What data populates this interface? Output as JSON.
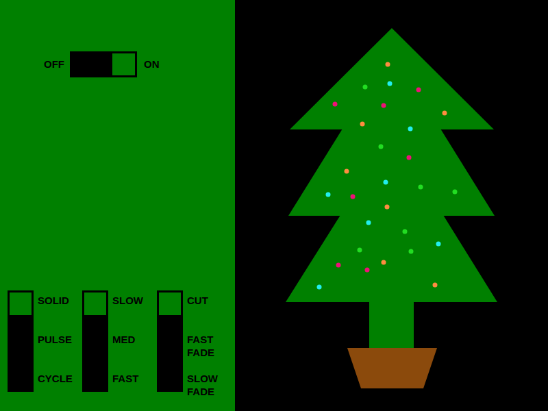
{
  "power": {
    "off_label": "OFF",
    "on_label": "ON",
    "on": true
  },
  "selectors": [
    {
      "name": "mode",
      "options": [
        {
          "label": "SOLID",
          "selected": true
        },
        {
          "label": "PULSE",
          "selected": false
        },
        {
          "label": "CYCLE",
          "selected": false
        }
      ]
    },
    {
      "name": "speed",
      "options": [
        {
          "label": "SLOW",
          "selected": true
        },
        {
          "label": "MED",
          "selected": false
        },
        {
          "label": "FAST",
          "selected": false
        }
      ]
    },
    {
      "name": "transition",
      "options": [
        {
          "label": "CUT",
          "selected": true
        },
        {
          "label": "FAST FADE",
          "selected": false
        },
        {
          "label": "SLOW FADE",
          "selected": false
        }
      ]
    }
  ],
  "lights": [
    {
      "color": "#ff8c40"
    },
    {
      "color": "#22dd22"
    },
    {
      "color": "#22eeee"
    },
    {
      "color": "#ee1177"
    },
    {
      "color": "#ee1177"
    },
    {
      "color": "#ee1177"
    },
    {
      "color": "#ff8c40"
    },
    {
      "color": "#ff8c40"
    },
    {
      "color": "#22eeee"
    },
    {
      "color": "#22dd22"
    },
    {
      "color": "#ee1177"
    },
    {
      "color": "#ff8c40"
    },
    {
      "color": "#22eeee"
    },
    {
      "color": "#22dd22"
    },
    {
      "color": "#22eeee"
    },
    {
      "color": "#ee1177"
    },
    {
      "color": "#22dd22"
    },
    {
      "color": "#ff8c40"
    },
    {
      "color": "#22eeee"
    },
    {
      "color": "#22dd22"
    },
    {
      "color": "#22eeee"
    },
    {
      "color": "#22dd22"
    },
    {
      "color": "#22dd22"
    },
    {
      "color": "#ee1177"
    },
    {
      "color": "#ff8c40"
    },
    {
      "color": "#ee1177"
    },
    {
      "color": "#22eeee"
    },
    {
      "color": "#ff8c40"
    }
  ]
}
